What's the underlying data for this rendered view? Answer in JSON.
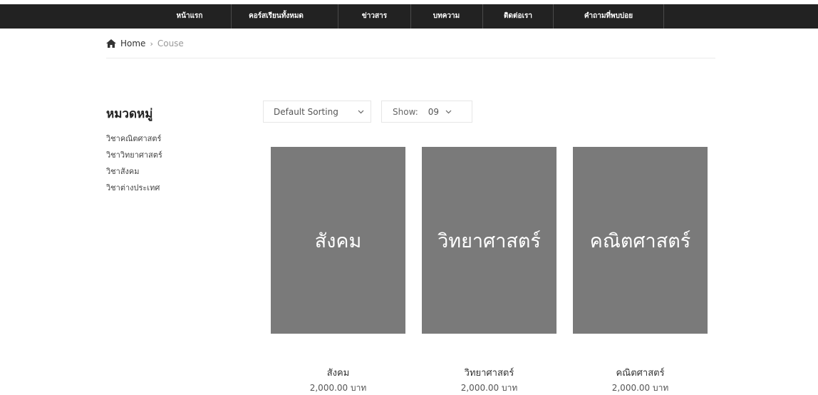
{
  "nav": {
    "items": [
      {
        "label": "หน้าแรก"
      },
      {
        "label": "คอร์สเรียนทั้งหมด"
      },
      {
        "label": "ข่าวสาร"
      },
      {
        "label": "บทความ"
      },
      {
        "label": "ติดต่อเรา"
      },
      {
        "label": "คำถามที่พบบ่อย"
      }
    ]
  },
  "breadcrumb": {
    "home": "Home",
    "current": "Couse"
  },
  "sidebar": {
    "title": "หมวดหมู่",
    "items": [
      {
        "label": "วิชาคณิตศาสตร์"
      },
      {
        "label": "วิชาวิทยาศาสตร์"
      },
      {
        "label": "วิชาสังคม"
      },
      {
        "label": "วิชาต่างประเทศ"
      }
    ]
  },
  "toolbar": {
    "sorting": "Default Sorting",
    "show_label": "Show:",
    "show_value": "09"
  },
  "products": [
    {
      "image_text": "สังคม",
      "title": "สังคม",
      "price": "2,000.00 บาท"
    },
    {
      "image_text": "วิทยาศาสตร์",
      "title": "วิทยาศาสตร์",
      "price": "2,000.00 บาท"
    },
    {
      "image_text": "คณิตศาสตร์",
      "title": "คณิตศาสตร์",
      "price": "2,000.00 บาท"
    }
  ]
}
